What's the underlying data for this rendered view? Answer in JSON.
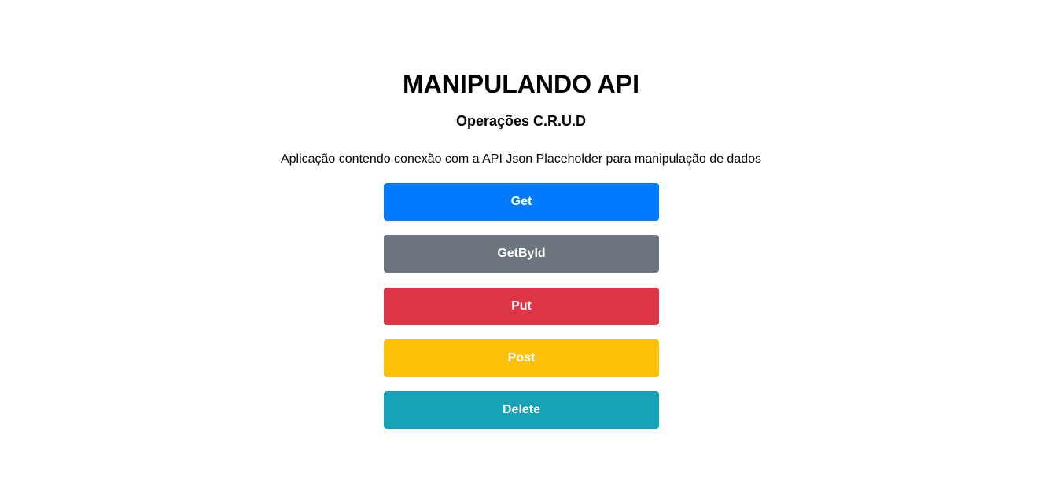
{
  "header": {
    "title": "MANIPULANDO API",
    "subtitle": "Operações C.R.U.D",
    "description": "Aplicação contendo conexão com a API Json Placeholder para manipulação de dados"
  },
  "buttons": [
    {
      "label": "Get",
      "color": "#007bff"
    },
    {
      "label": "GetById",
      "color": "#6c757d"
    },
    {
      "label": "Put",
      "color": "#dc3545"
    },
    {
      "label": "Post",
      "color": "#ffc107"
    },
    {
      "label": "Delete",
      "color": "#17a2b8"
    }
  ]
}
